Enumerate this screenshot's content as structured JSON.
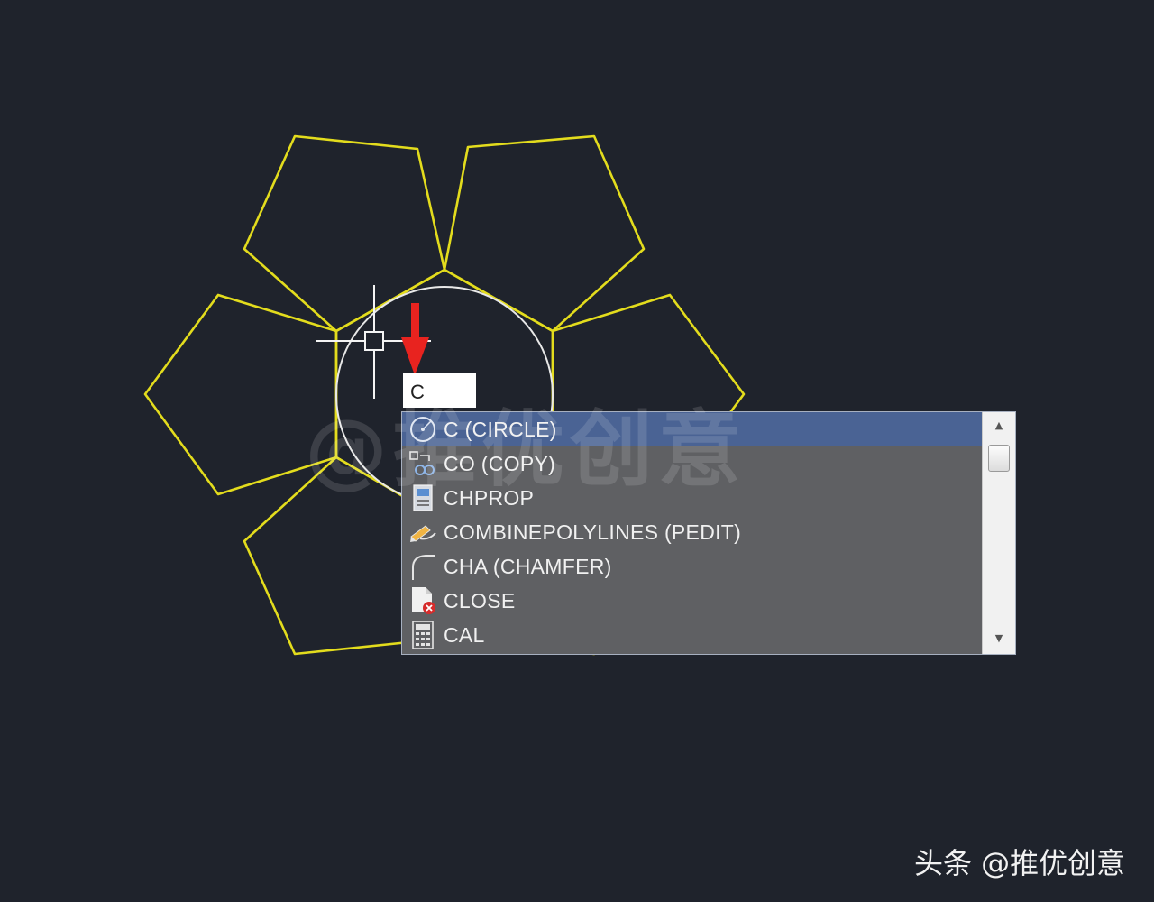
{
  "command_line": {
    "value": "C"
  },
  "watermark": {
    "text": "@推优创意"
  },
  "autocomplete": {
    "items": [
      {
        "label": "C (CIRCLE)",
        "icon": "circle-icon",
        "selected": true
      },
      {
        "label": "CO (COPY)",
        "icon": "copy-icon",
        "selected": false
      },
      {
        "label": "CHPROP",
        "icon": "properties-icon",
        "selected": false
      },
      {
        "label": "COMBINEPOLYLINES (PEDIT)",
        "icon": "pencil-edit-icon",
        "selected": false
      },
      {
        "label": "CHA (CHAMFER)",
        "icon": "chamfer-icon",
        "selected": false
      },
      {
        "label": "CLOSE",
        "icon": "close-file-icon",
        "selected": false
      },
      {
        "label": "CAL",
        "icon": "calculator-icon",
        "selected": false
      }
    ]
  },
  "footer": {
    "credit": "头条 @推优创意"
  },
  "colors": {
    "background": "#1f232c",
    "pentagon_stroke": "#e3dc1d",
    "circle_stroke": "#e8e8e8",
    "selection": "#4a6394",
    "arrow": "#e8231f"
  }
}
